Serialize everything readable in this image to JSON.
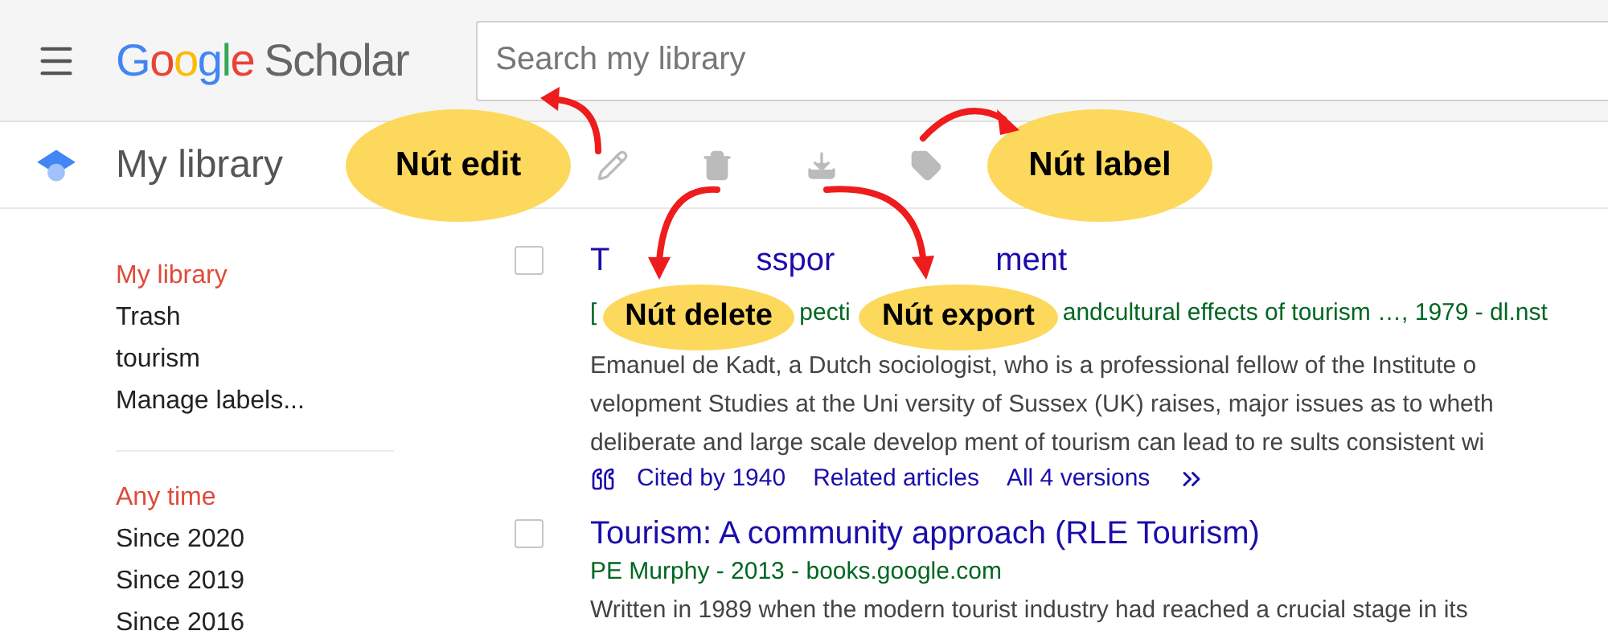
{
  "header": {
    "logo": {
      "brand": "Google",
      "product": "Scholar"
    },
    "search": {
      "placeholder": "Search my library"
    }
  },
  "toolbar": {
    "title": "My library",
    "actions": [
      {
        "kind": "edit"
      },
      {
        "kind": "delete"
      },
      {
        "kind": "export"
      },
      {
        "kind": "label"
      }
    ]
  },
  "sidebar": {
    "groups": [
      {
        "items": [
          {
            "label": "My library",
            "selected": true
          },
          {
            "label": "Trash",
            "selected": false
          },
          {
            "label": "tourism",
            "selected": false
          },
          {
            "label": "Manage labels...",
            "selected": false
          }
        ]
      },
      {
        "items": [
          {
            "label": "Any time",
            "selected": true
          },
          {
            "label": "Since 2020",
            "selected": false
          },
          {
            "label": "Since 2019",
            "selected": false
          },
          {
            "label": "Since 2016",
            "selected": false
          }
        ]
      }
    ]
  },
  "results": [
    {
      "checked": false,
      "title_parts": [
        "T",
        "sspor",
        "ment"
      ],
      "source_parts": [
        "[",
        "pecti",
        "andcultural effects of tourism …, 1979 - dl.nst"
      ],
      "snippet": [
        "Emanuel de Kadt, a Dutch sociologist, who is a professional fellow of the Institute o",
        "velopment Studies at the Uni versity of Sussex (UK) raises, major issues as to wheth",
        "deliberate and large scale develop ment of tourism can lead to re sults consistent wi"
      ],
      "links": [
        "Cited by 1940",
        "Related articles",
        "All 4 versions"
      ]
    },
    {
      "checked": false,
      "title_parts": [
        "Tourism: A community approach (RLE Tourism)"
      ],
      "source_parts": [
        "PE Murphy - 2013 - books.google.com"
      ],
      "snippet": [
        "Written in 1989 when the modern tourist industry had reached a crucial stage in its"
      ]
    }
  ],
  "annotations": [
    {
      "label": "Nút edit"
    },
    {
      "label": "Nút delete"
    },
    {
      "label": "Nút export"
    },
    {
      "label": "Nút label"
    }
  ]
}
